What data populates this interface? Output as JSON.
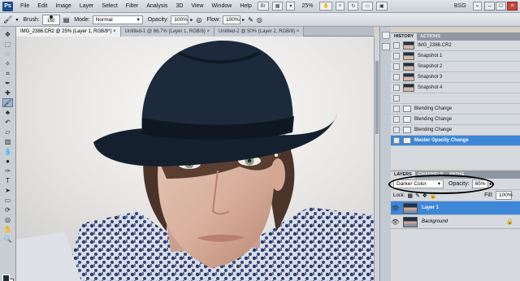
{
  "menubar": {
    "logo": "Ps",
    "items": [
      "File",
      "Edit",
      "Image",
      "Layer",
      "Select",
      "Filter",
      "Analysis",
      "3D",
      "View",
      "Window",
      "Help"
    ],
    "zoom": "25%",
    "workspace": "BSG"
  },
  "options": {
    "brush_label": "Brush:",
    "brush_size": "150",
    "mode_label": "Mode:",
    "mode_value": "Normal",
    "opacity_label": "Opacity:",
    "opacity_value": "100%",
    "flow_label": "Flow:",
    "flow_value": "100%"
  },
  "doc_tabs": [
    {
      "label": "IMG_2386.CR2 @ 25% (Layer 1, RGB/8*) ×"
    },
    {
      "label": "Untitled-1 @ 66.7% (Layer 1, RGB/8) ×"
    },
    {
      "label": "Untitled-2 @ 50% (Layer 2, RGB/8) ×"
    }
  ],
  "history": {
    "tabs": [
      "HISTORY",
      "ACTIONS"
    ],
    "items": [
      {
        "label": "IMG_2386.CR2",
        "kind": "snapshot"
      },
      {
        "label": "Snapshot 1",
        "kind": "snapshot"
      },
      {
        "label": "Snapshot 2",
        "kind": "snapshot"
      },
      {
        "label": "Snapshot 3",
        "kind": "snapshot"
      },
      {
        "label": "Snapshot 4",
        "kind": "snapshot"
      },
      {
        "label": "",
        "kind": "blank"
      },
      {
        "label": "Blending Change",
        "kind": "state"
      },
      {
        "label": "Blending Change",
        "kind": "state"
      },
      {
        "label": "Blending Change",
        "kind": "state"
      },
      {
        "label": "Master Opacity Change",
        "kind": "state",
        "selected": true
      }
    ]
  },
  "layers": {
    "tabs": [
      "LAYERS",
      "CHANNELS",
      "PATHS"
    ],
    "blend_mode": "Darker Color",
    "opacity_label": "Opacity:",
    "opacity_value": "65%",
    "lock_label": "Lock:",
    "fill_label": "Fill:",
    "fill_value": "100%",
    "items": [
      {
        "name": "Layer 1",
        "selected": true
      },
      {
        "name": "Background",
        "selected": false
      }
    ]
  },
  "colors": {
    "accent": "#3d86d8",
    "foreground": "#1f2b3a",
    "background": "#ffffff"
  }
}
